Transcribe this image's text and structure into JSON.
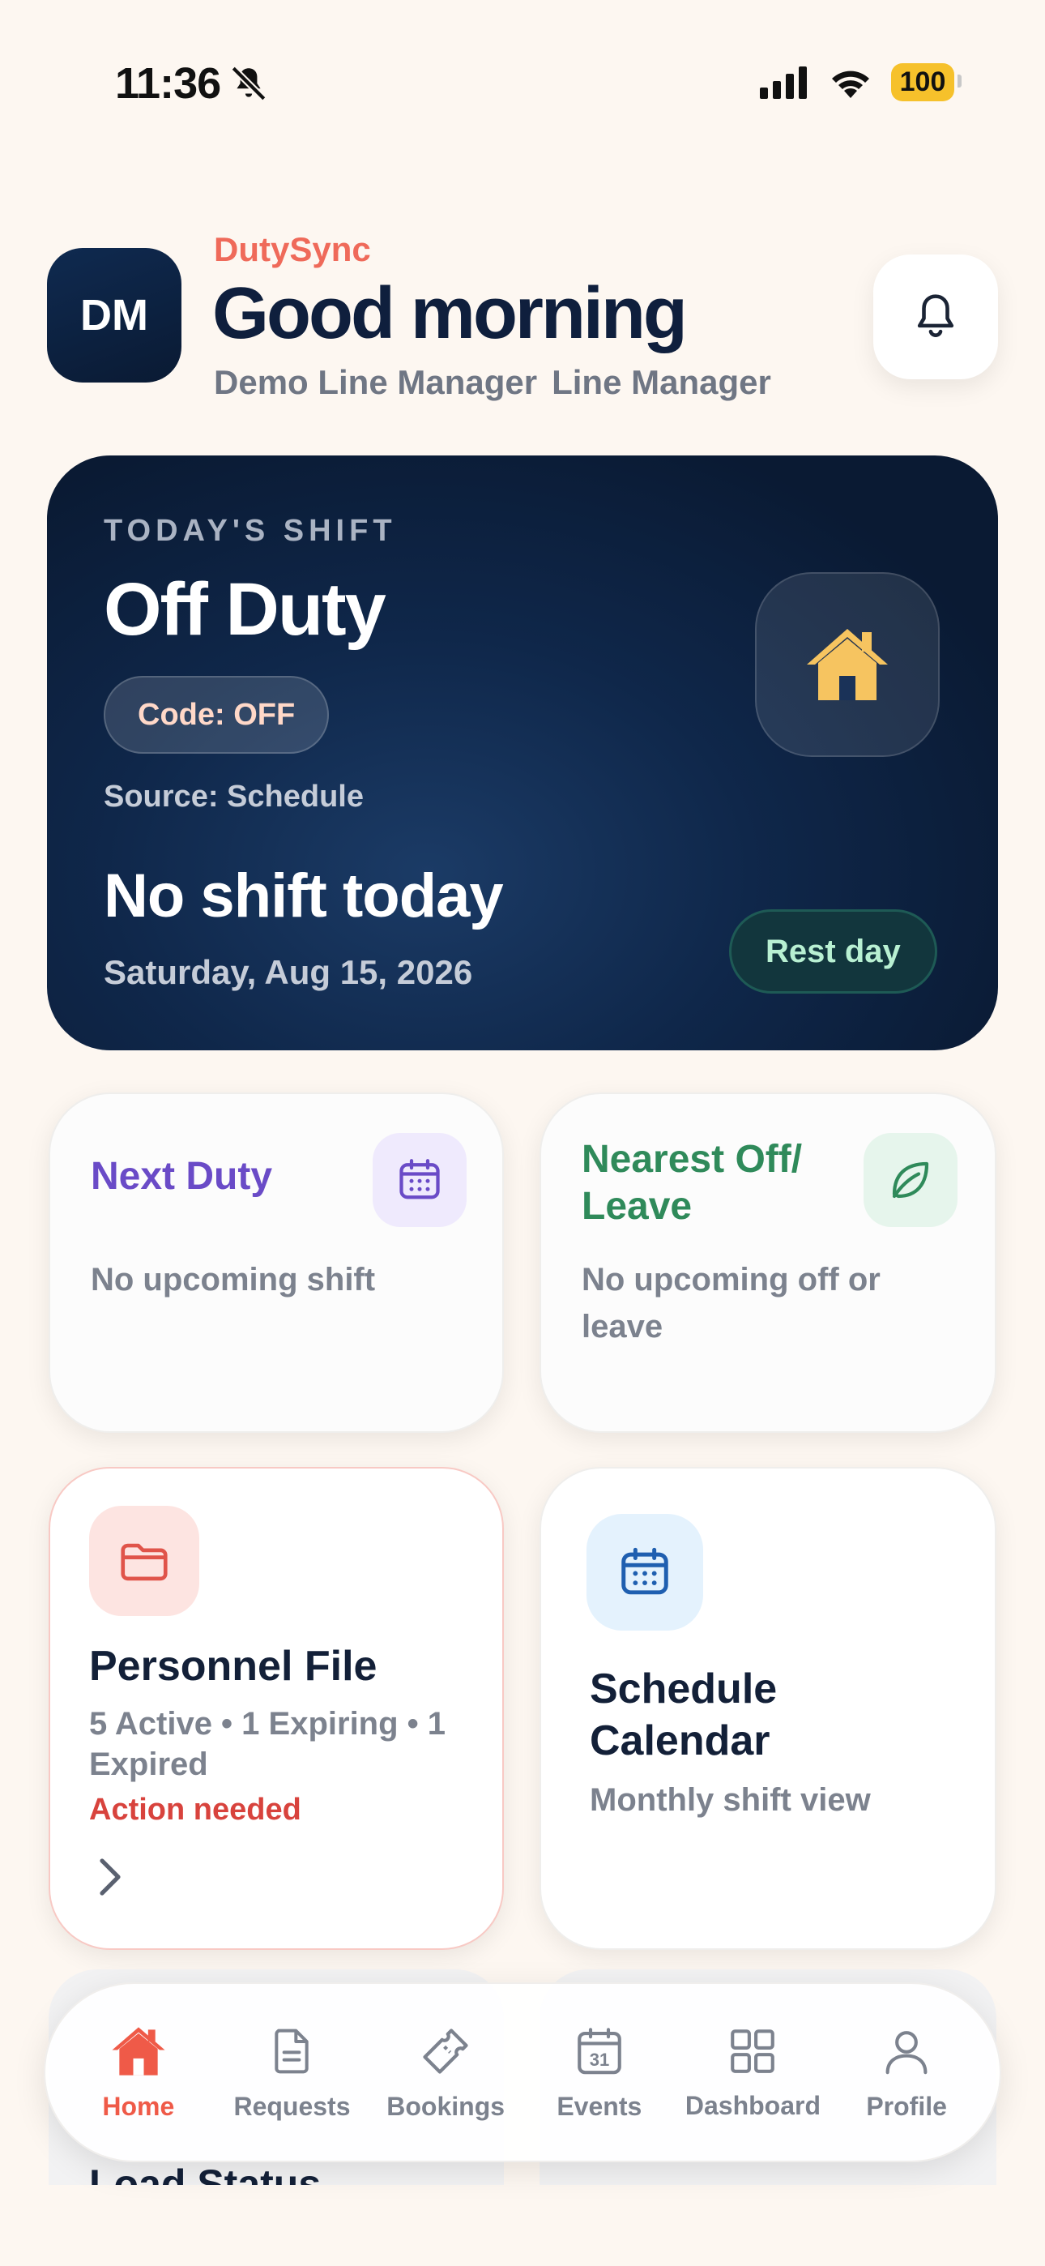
{
  "status_bar": {
    "time": "11:36",
    "battery": "100"
  },
  "header": {
    "avatar_initials": "DM",
    "brand": "DutySync",
    "greeting": "Good morning",
    "user_name": "Demo Line Manager",
    "user_role": "Line Manager"
  },
  "today_shift": {
    "kicker": "TODAY'S SHIFT",
    "title": "Off Duty",
    "code": "Code: OFF",
    "source": "Source: Schedule",
    "message": "No shift today",
    "date": "Saturday, Aug 15, 2026",
    "badge": "Rest day"
  },
  "cards": {
    "next_duty": {
      "title": "Next Duty",
      "body": "No upcoming shift"
    },
    "nearest_off": {
      "title": "Nearest Off/ Leave",
      "body": "No upcoming off or leave"
    },
    "personnel_file": {
      "title": "Personnel File",
      "meta": "5 Active • 1 Expiring • 1 Expired",
      "action": "Action needed"
    },
    "schedule_calendar": {
      "title": "Schedule Calendar",
      "subtitle": "Monthly shift view"
    }
  },
  "peek": {
    "left_title": "Load Status"
  },
  "nav": {
    "items": [
      {
        "label": "Home",
        "icon": "home-icon"
      },
      {
        "label": "Requests",
        "icon": "document-icon"
      },
      {
        "label": "Bookings",
        "icon": "ticket-icon"
      },
      {
        "label": "Events",
        "icon": "calendar-icon"
      },
      {
        "label": "Dashboard",
        "icon": "grid-icon"
      },
      {
        "label": "Profile",
        "icon": "user-icon"
      }
    ],
    "active": "Home"
  },
  "colors": {
    "accent": "#ef5a48",
    "navy": "#0a1a33",
    "purple": "#6a4bc7",
    "green": "#2f8a5a",
    "alert": "#d8433d"
  }
}
